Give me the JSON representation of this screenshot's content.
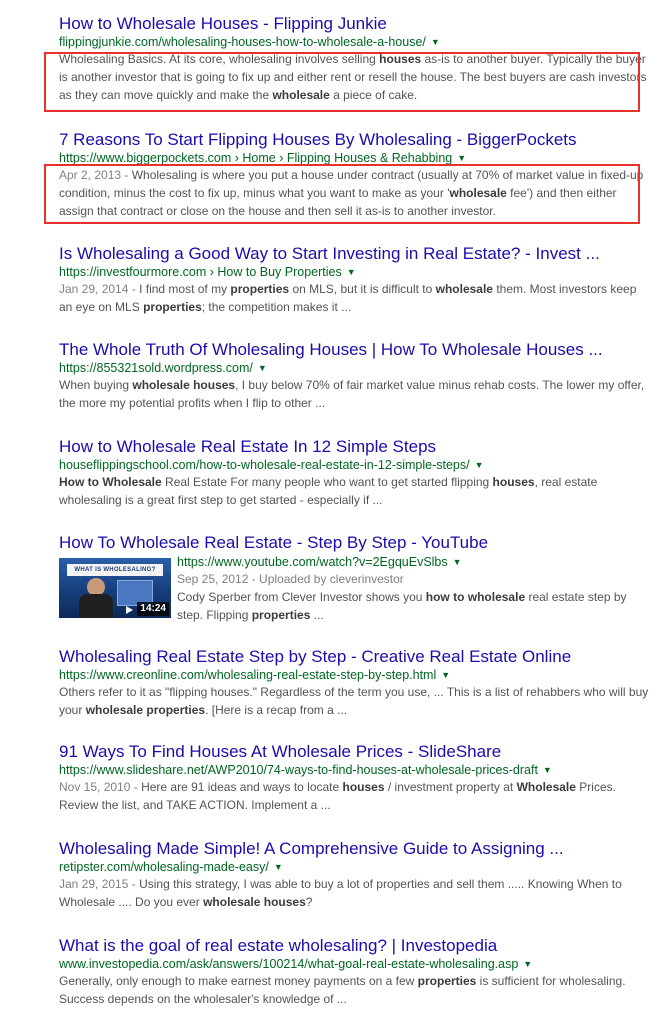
{
  "results": [
    {
      "title": "How to Wholesale Houses - Flipping Junkie",
      "url": "flippingjunkie.com/wholesaling-houses-how-to-wholesale-a-house/",
      "snippet": [
        {
          "t": "Wholesaling Basics. At its core, wholesaling involves selling "
        },
        {
          "t": "houses",
          "b": true
        },
        {
          "t": " as-is to another buyer. Typically the buyer is another investor that is going to fix up and either rent or resell the house. The best buyers are cash investors as they can move quickly and make the "
        },
        {
          "t": "wholesale",
          "b": true
        },
        {
          "t": " a piece of cake."
        }
      ],
      "highlighted": true
    },
    {
      "title": "7 Reasons To Start Flipping Houses By Wholesaling - BiggerPockets",
      "url": "https://www.biggerpockets.com › Home › Flipping Houses & Rehabbing",
      "date": "Apr 2, 2013 - ",
      "snippet": [
        {
          "t": "Wholesaling is where you put a house under contract (usually at 70% of market value in fixed-up condition, minus the cost to fix up, minus what you want to make as your '"
        },
        {
          "t": "wholesale",
          "b": true
        },
        {
          "t": " fee') and then either assign that contract or close on the house and then sell it as-is to another investor."
        }
      ],
      "highlighted": true
    },
    {
      "title": "Is Wholesaling a Good Way to Start Investing in Real Estate? - Invest ...",
      "url": "https://investfourmore.com › How to Buy Properties",
      "date": "Jan 29, 2014 - ",
      "snippet": [
        {
          "t": "I find most of my "
        },
        {
          "t": "properties",
          "b": true
        },
        {
          "t": " on MLS, but it is difficult to "
        },
        {
          "t": "wholesale",
          "b": true
        },
        {
          "t": " them. Most investors keep an eye on MLS "
        },
        {
          "t": "properties",
          "b": true
        },
        {
          "t": "; the competition makes it ..."
        }
      ]
    },
    {
      "title": "The Whole Truth Of Wholesaling Houses | How To Wholesale Houses ...",
      "url": "https://855321sold.wordpress.com/",
      "snippet": [
        {
          "t": "When buying "
        },
        {
          "t": "wholesale houses",
          "b": true
        },
        {
          "t": ", I buy below 70% of fair market value minus rehab costs. The lower my offer, the more my potential profits when I flip to other ..."
        }
      ]
    },
    {
      "title": "How to Wholesale Real Estate In 12 Simple Steps",
      "url": "houseflippingschool.com/how-to-wholesale-real-estate-in-12-simple-steps/",
      "snippet": [
        {
          "t": "How to Wholesale",
          "b": true
        },
        {
          "t": " Real Estate For many people who want to get started flipping "
        },
        {
          "t": "houses",
          "b": true
        },
        {
          "t": ", real estate wholesaling is a great first step to get started - especially if ..."
        }
      ]
    },
    {
      "title": "How To Wholesale Real Estate - Step By Step - YouTube",
      "url": "https://www.youtube.com/watch?v=2EgquEvSlbs",
      "video": {
        "thumb_text": "WHAT IS WHOLESALING?",
        "duration": "14:24",
        "meta": "Sep 25, 2012 - Uploaded by cleverinvestor"
      },
      "snippet": [
        {
          "t": "Cody Sperber from Clever Investor shows you "
        },
        {
          "t": "how to wholesale",
          "b": true
        },
        {
          "t": " real estate step by step. Flipping "
        },
        {
          "t": "properties",
          "b": true
        },
        {
          "t": " ..."
        }
      ]
    },
    {
      "title": "Wholesaling Real Estate Step by Step - Creative Real Estate Online",
      "url": "https://www.creonline.com/wholesaling-real-estate-step-by-step.html",
      "snippet": [
        {
          "t": "Others refer to it as \"flipping houses.\" Regardless of the term you use, ... This is a list of rehabbers who will buy your "
        },
        {
          "t": "wholesale properties",
          "b": true
        },
        {
          "t": ". [Here is a recap from a ..."
        }
      ]
    },
    {
      "title": "91 Ways To Find Houses At Wholesale Prices - SlideShare",
      "url": "https://www.slideshare.net/AWP2010/74-ways-to-find-houses-at-wholesale-prices-draft",
      "date": "Nov 15, 2010 - ",
      "snippet": [
        {
          "t": "Here are 91 ideas and ways to locate "
        },
        {
          "t": "houses",
          "b": true
        },
        {
          "t": " / investment property at "
        },
        {
          "t": "Wholesale",
          "b": true
        },
        {
          "t": " Prices. Review the list, and TAKE ACTION. Implement a ..."
        }
      ]
    },
    {
      "title": "Wholesaling Made Simple! A Comprehensive Guide to Assigning ...",
      "url": "retipster.com/wholesaling-made-easy/",
      "date": "Jan 29, 2015 - ",
      "snippet": [
        {
          "t": "Using this strategy, I was able to buy a lot of properties and sell them ..... Knowing When to Wholesale .... Do you ever "
        },
        {
          "t": "wholesale houses",
          "b": true
        },
        {
          "t": "?"
        }
      ]
    },
    {
      "title": "What is the goal of real estate wholesaling? | Investopedia",
      "url": "www.investopedia.com/ask/answers/100214/what-goal-real-estate-wholesaling.asp",
      "snippet": [
        {
          "t": "Generally, only enough to make earnest money payments on a few "
        },
        {
          "t": "properties",
          "b": true
        },
        {
          "t": " is sufficient for wholesaling. Success depends on the wholesaler's knowledge of ..."
        }
      ]
    }
  ]
}
